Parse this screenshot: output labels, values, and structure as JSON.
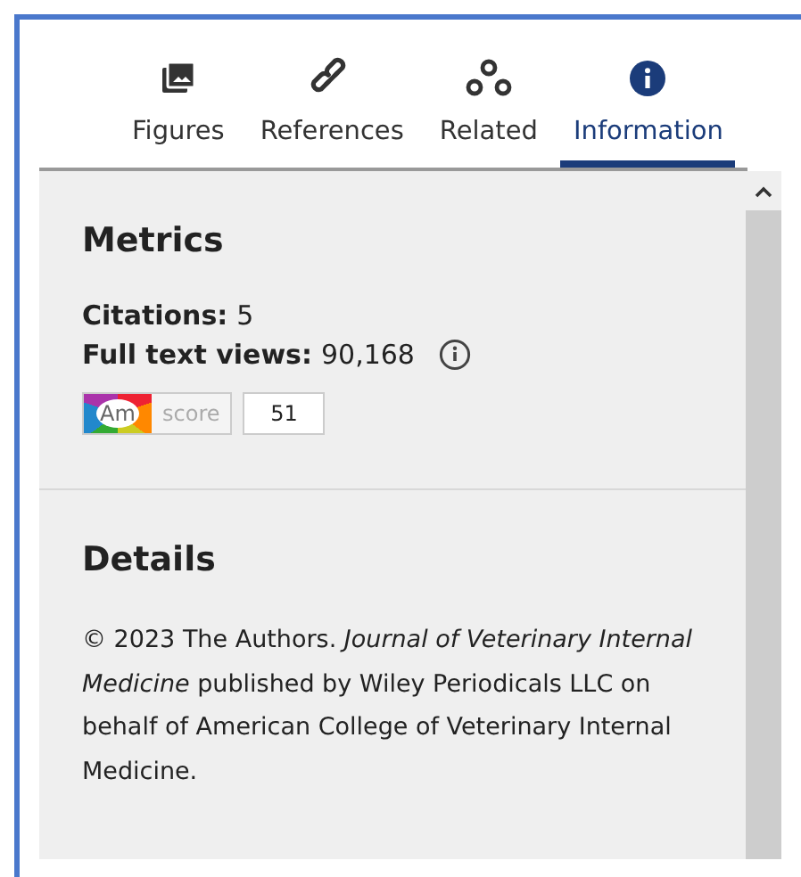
{
  "tabs": [
    {
      "label": "Figures",
      "kind": "figures",
      "selected": false
    },
    {
      "label": "References",
      "kind": "references",
      "selected": false
    },
    {
      "label": "Related",
      "kind": "related",
      "selected": false
    },
    {
      "label": "Information",
      "kind": "information",
      "selected": true
    }
  ],
  "metrics": {
    "title": "Metrics",
    "items": [
      {
        "label": "Citations:",
        "value": "5",
        "info": false
      },
      {
        "label": "Full text views:",
        "value": "90,168",
        "info": true
      }
    ],
    "altmetric": {
      "logo": "Am",
      "label": "score",
      "value": "51"
    }
  },
  "details": {
    "title": "Details",
    "text": "© 2023 The Authors. *Journal of Veterinary Internal Medicine* published by Wiley Periodicals LLC on behalf of American College of Veterinary Internal Medicine."
  }
}
